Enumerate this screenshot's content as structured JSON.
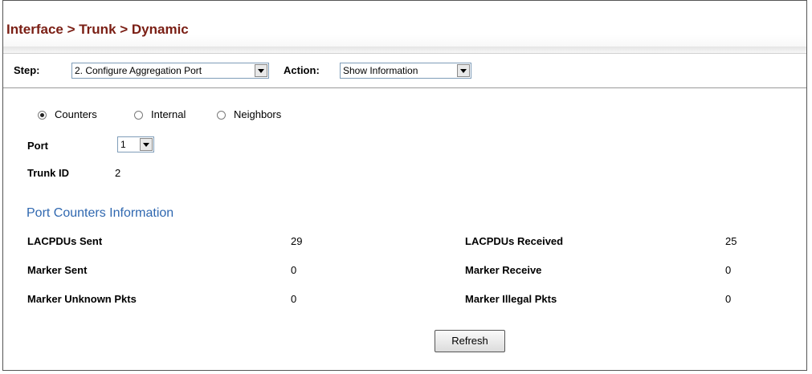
{
  "page": {
    "title": "Interface > Trunk > Dynamic"
  },
  "toolbar": {
    "step_label": "Step:",
    "step_value": "2. Configure Aggregation Port",
    "action_label": "Action:",
    "action_value": "Show Information"
  },
  "view_options": {
    "selected": "Counters",
    "items": [
      "Counters",
      "Internal",
      "Neighbors"
    ]
  },
  "port": {
    "label": "Port",
    "value": "1"
  },
  "trunk": {
    "label": "Trunk ID",
    "value": "2"
  },
  "section": {
    "title": "Port Counters Information"
  },
  "counters": [
    {
      "left_label": "LACPDUs Sent",
      "left_value": "29",
      "right_label": "LACPDUs Received",
      "right_value": "25"
    },
    {
      "left_label": "Marker Sent",
      "left_value": "0",
      "right_label": "Marker Receive",
      "right_value": "0"
    },
    {
      "left_label": "Marker Unknown Pkts",
      "left_value": "0",
      "right_label": "Marker Illegal Pkts",
      "right_value": "0"
    }
  ],
  "buttons": {
    "refresh": "Refresh"
  }
}
